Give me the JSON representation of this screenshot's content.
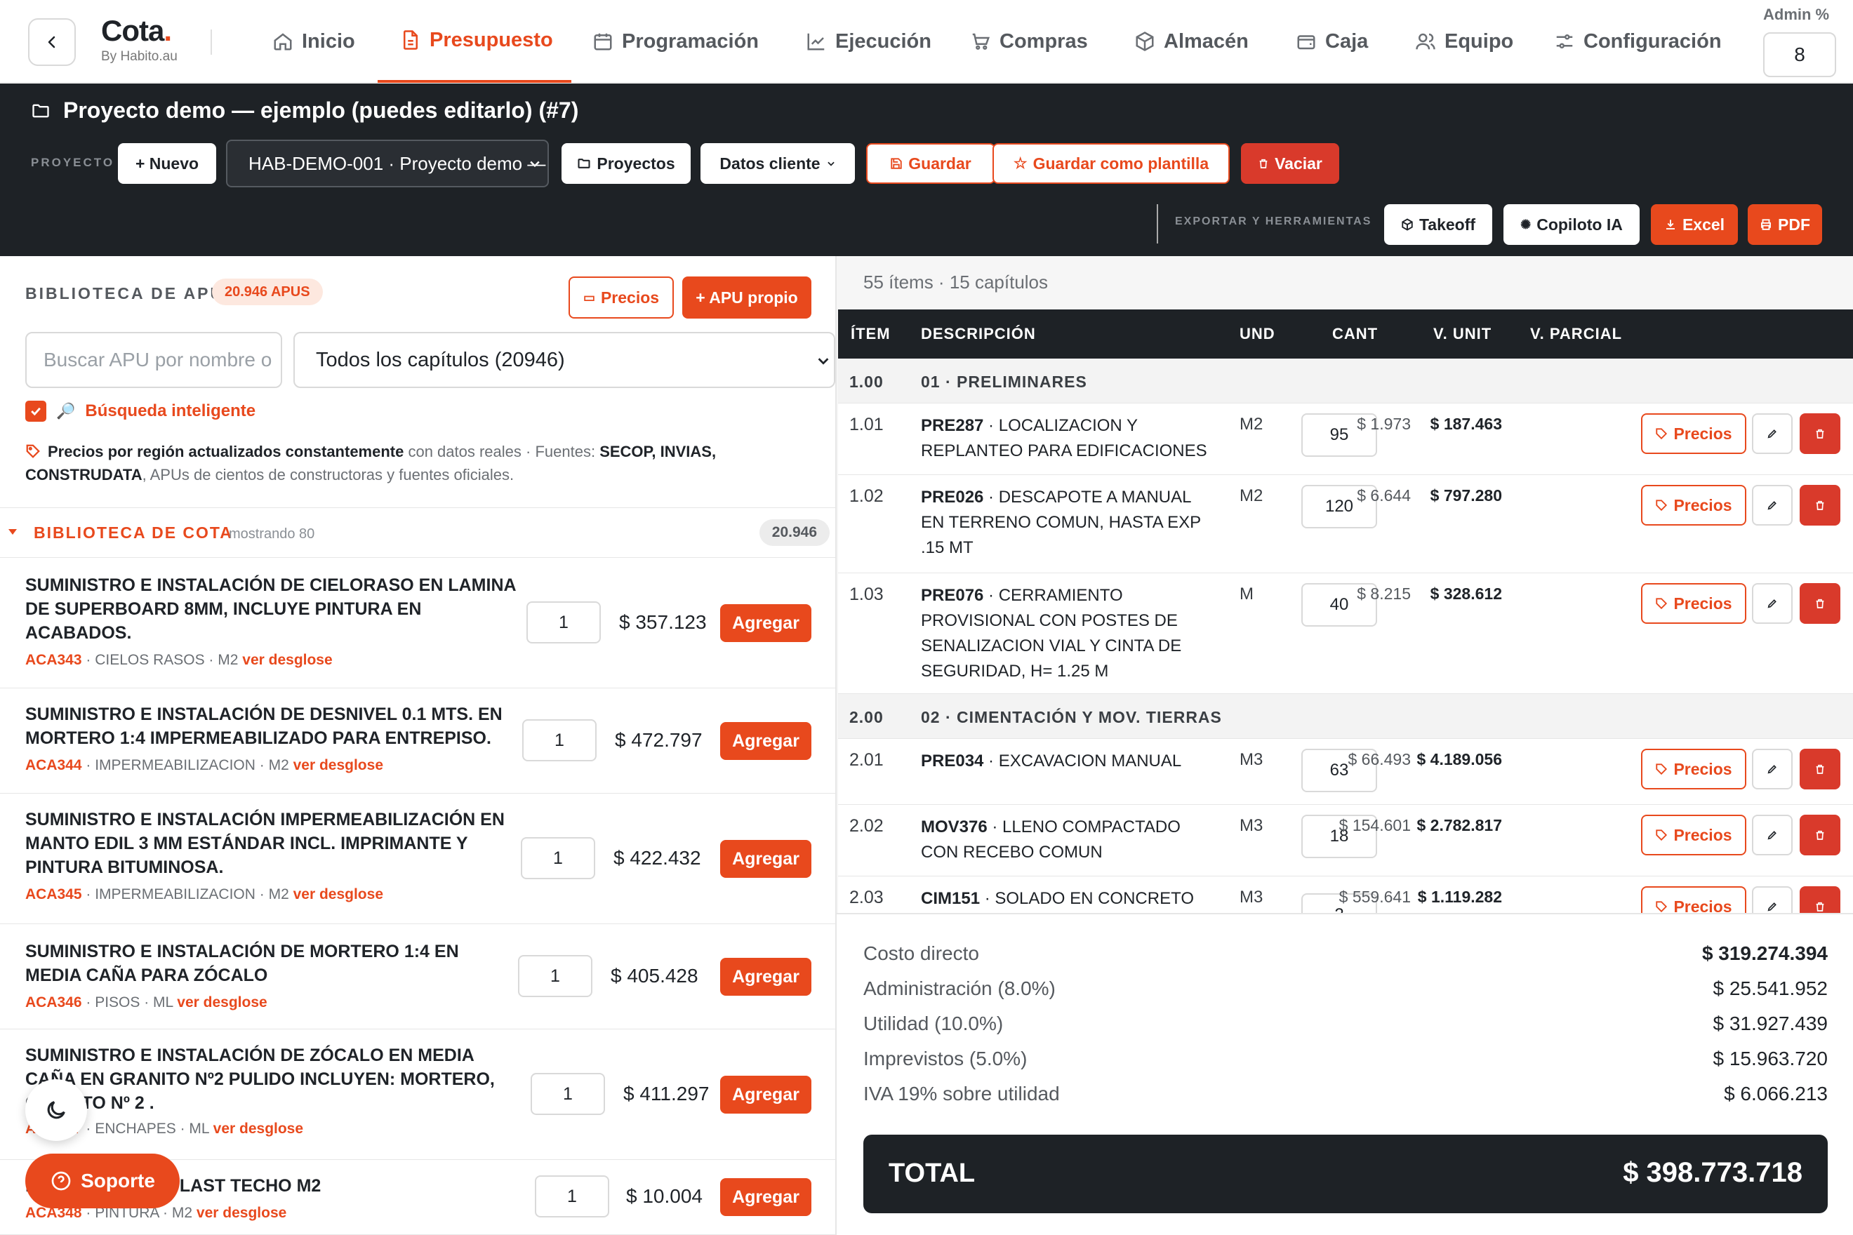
{
  "brand": {
    "name": "Cota",
    "dot": ".",
    "sub": "By Habito.au"
  },
  "nav": [
    {
      "label": "Inicio",
      "icon": "home-icon"
    },
    {
      "label": "Presupuesto",
      "icon": "document-icon",
      "active": true
    },
    {
      "label": "Programación",
      "icon": "calendar-icon"
    },
    {
      "label": "Ejecución",
      "icon": "chart-line-icon"
    },
    {
      "label": "Compras",
      "icon": "cart-icon"
    },
    {
      "label": "Almacén",
      "icon": "box-icon"
    },
    {
      "label": "Caja",
      "icon": "wallet-icon"
    },
    {
      "label": "Equipo",
      "icon": "users-icon"
    },
    {
      "label": "Configuración",
      "icon": "sliders-icon"
    }
  ],
  "admin": {
    "label": "Admin %",
    "value": "8"
  },
  "project": {
    "title": "Proyecto demo — ejemplo (puedes editarlo) (#7)",
    "section_label": "PROYECTO",
    "new_label": "+ Nuevo",
    "selected": "HAB-DEMO-001 · Proyecto demo —",
    "projects_label": "Proyectos",
    "client_label": "Datos cliente",
    "save_label": "Guardar",
    "save_template_label": "Guardar como plantilla",
    "clear_label": "Vaciar"
  },
  "export": {
    "label": "EXPORTAR Y HERRAMIENTAS",
    "takeoff": "Takeoff",
    "copilot": "Copiloto IA",
    "excel": "Excel",
    "pdf": "PDF"
  },
  "library": {
    "title": "BIBLIOTECA DE APU",
    "badge": "20.946 APUS",
    "prices_btn": "Precios",
    "own_btn": "+ APU propio",
    "search_placeholder": "Buscar APU por nombre o",
    "chapter_select": "Todos los capítulos (20946)",
    "smart_search": "Búsqueda inteligente",
    "note_bold": "Precios por región actualizados constantemente",
    "note_rest": " con datos reales · Fuentes: ",
    "note_sources": "SECOP, INVIAS, CONSTRUDATA",
    "note_tail": ", APUs de cientos de constructoras y fuentes oficiales.",
    "section_title": "BIBLIOTECA DE COTA",
    "showing": "mostrando 80",
    "count": "20.946",
    "link_label": "ver desglose",
    "add_label": "Agregar",
    "items": [
      {
        "title": "SUMINISTRO E INSTALACIÓN DE CIELORASO EN LAMINA DE SUPERBOARD 8MM, INCLUYE PINTURA EN ACABADOS.",
        "code": "ACA343",
        "meta": " · CIELOS RASOS · M2 ",
        "qty": "1",
        "price": "$ 357.123"
      },
      {
        "title": "SUMINISTRO E INSTALACIÓN DE DESNIVEL 0.1 MTS. EN MORTERO 1:4 IMPERMEABILIZADO PARA ENTREPISO.",
        "code": "ACA344",
        "meta": " · IMPERMEABILIZACION · M2 ",
        "qty": "1",
        "price": "$ 472.797"
      },
      {
        "title": "SUMINISTRO E INSTALACIÓN IMPERMEABILIZACIÓN EN MANTO EDIL 3 MM ESTÁNDAR INCL. IMPRIMANTE Y PINTURA BITUMINOSA.",
        "code": "ACA345",
        "meta": " · IMPERMEABILIZACION · M2 ",
        "qty": "1",
        "price": "$ 422.432"
      },
      {
        "title": "SUMINISTRO E INSTALACIÓN DE MORTERO 1:4 EN MEDIA CAÑA PARA ZÓCALO",
        "code": "ACA346",
        "meta": " · PISOS · ML ",
        "qty": "1",
        "price": "$ 405.428"
      },
      {
        "title": "SUMINISTRO E INSTALACIÓN DE ZÓCALO EN MEDIA CAÑA EN GRANITO Nº2 PULIDO INCLUYEN: MORTERO, GRANITO Nº 2 .",
        "code": "ACA347",
        "meta": " · ENCHAPES · ML ",
        "qty": "1",
        "price": "$ 411.297"
      },
      {
        "title": "PINTURA TERRAPLAST TECHO M2",
        "code": "ACA348",
        "meta": " · PINTURA · M2 ",
        "qty": "1",
        "price": "$ 10.004"
      }
    ]
  },
  "budget": {
    "summary": "55 ítems · 15 capítulos",
    "headers": {
      "item": "ÍTEM",
      "desc": "DESCRIPCIÓN",
      "und": "UND",
      "cant": "CANT",
      "vunit": "V. UNIT",
      "vparcial": "V. PARCIAL"
    },
    "prices_label": "Precios",
    "chapters": [
      {
        "num": "1.00",
        "name": "01 · PRELIMINARES"
      },
      {
        "num": "2.00",
        "name": "02 · CIMENTACIÓN Y MOV. TIERRAS"
      }
    ],
    "rows": [
      {
        "item": "1.01",
        "code": "PRE287",
        "desc": " · LOCALIZACION Y REPLANTEO PARA EDIFICACIONES",
        "und": "M2",
        "cant": "95",
        "vunit": "$ 1.973",
        "vparcial": "$ 187.463"
      },
      {
        "item": "1.02",
        "code": "PRE026",
        "desc": " · DESCAPOTE A MANUAL EN TERRENO COMUN, HASTA EXP .15 MT",
        "und": "M2",
        "cant": "120",
        "vunit": "$ 6.644",
        "vparcial": "$ 797.280"
      },
      {
        "item": "1.03",
        "code": "PRE076",
        "desc": " · CERRAMIENTO PROVISIONAL CON POSTES DE SENALIZACION VIAL Y CINTA DE SEGURIDAD, H= 1.25 M",
        "und": "M",
        "cant": "40",
        "vunit": "$ 8.215",
        "vparcial": "$ 328.612"
      },
      {
        "item": "2.01",
        "code": "PRE034",
        "desc": " · EXCAVACION MANUAL",
        "und": "M3",
        "cant": "63",
        "vunit": "$ 66.493",
        "vparcial": "$ 4.189.056"
      },
      {
        "item": "2.02",
        "code": "MOV376",
        "desc": " · LLENO COMPACTADO CON RECEBO COMUN",
        "und": "M3",
        "cant": "18",
        "vunit": "$ 154.601",
        "vparcial": "$ 2.782.817"
      },
      {
        "item": "2.03",
        "code": "CIM151",
        "desc": " · SOLADO EN CONCRETO DE",
        "und": "M3",
        "cant": "2",
        "vunit": "$ 559.641",
        "vparcial": "$ 1.119.282"
      }
    ]
  },
  "totals": {
    "direct_label": "Costo directo",
    "direct": "$ 319.274.394",
    "admin_label": "Administración (8.0%)",
    "admin": "$ 25.541.952",
    "util_label": "Utilidad (10.0%)",
    "util": "$ 31.927.439",
    "impr_label": "Imprevistos (5.0%)",
    "impr": "$ 15.963.720",
    "iva_label": "IVA 19% sobre utilidad",
    "iva": "$ 6.066.213",
    "total_label": "TOTAL",
    "total": "$ 398.773.718"
  },
  "support_label": "Soporte",
  "colors": {
    "accent": "#e8491d",
    "dark": "#1e2226",
    "danger": "#d93a2b"
  }
}
